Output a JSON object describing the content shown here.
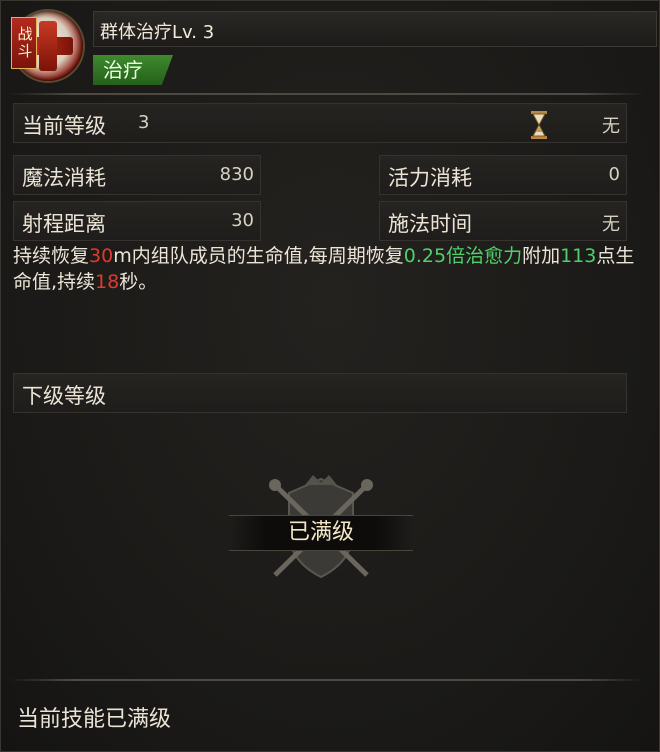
{
  "header": {
    "battle_tag": "战斗",
    "skill_title": "群体治疗Lv. 3",
    "type_tag": "治疗"
  },
  "stats": {
    "current_level_label": "当前等级",
    "current_level_value": "3",
    "hourglass_value": "无",
    "mana_label": "魔法消耗",
    "mana_value": "830",
    "vitality_label": "活力消耗",
    "vitality_value": "0",
    "range_label": "射程距离",
    "range_value": "30",
    "cast_label": "施法时间",
    "cast_value": "无"
  },
  "description": {
    "p1": "持续恢复",
    "range": "30",
    "p2": "m内组队成员的生命值,每周期恢复",
    "ratio": "0.25倍治愈力",
    "p3": "附加",
    "bonus": "113",
    "p4": "点生命值,持续",
    "duration": "18",
    "p5": "秒。"
  },
  "next_level_label": "下级等级",
  "max_level_banner": "已满级",
  "footer": "当前技能已满级",
  "colors": {
    "highlight_red": "#e03a2c",
    "highlight_green": "#4fd06a",
    "type_tag_green": "#3f8a2e"
  }
}
